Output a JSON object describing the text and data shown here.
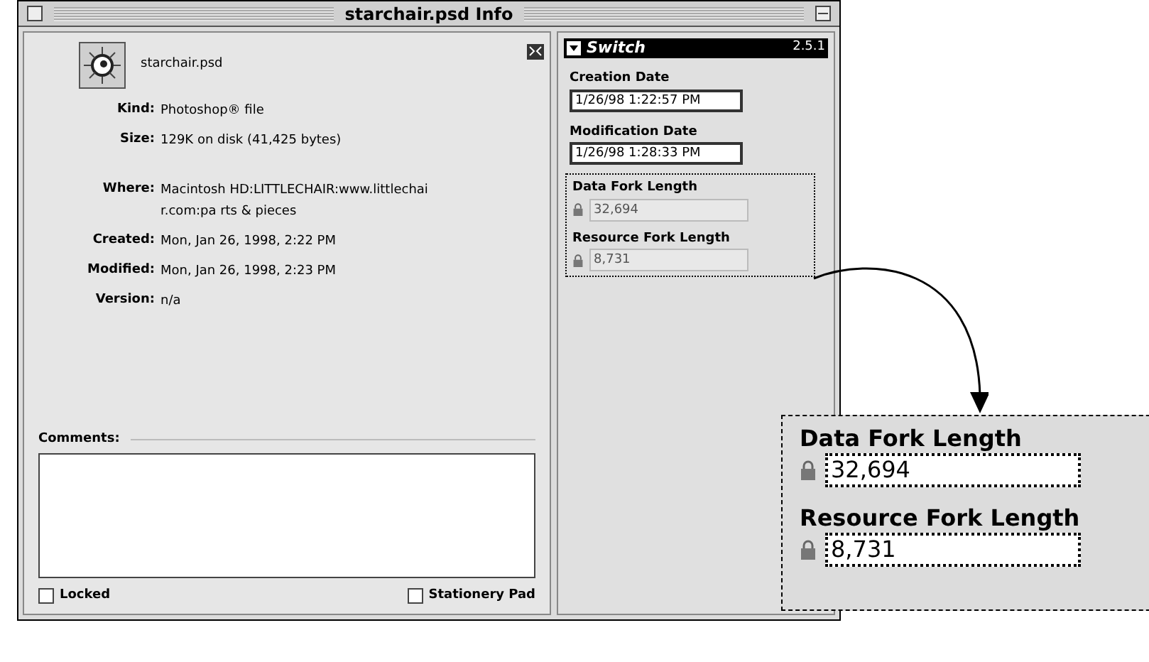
{
  "window": {
    "title": "starchair.psd Info"
  },
  "file": {
    "name": "starchair.psd"
  },
  "info": [
    {
      "label": "Kind:",
      "value": "Photoshop® file"
    },
    {
      "label": "Size:",
      "value": "129K on disk (41,425 bytes)"
    },
    {
      "label": "Where:",
      "value": "Macintosh HD:LITTLECHAIR:www.littlechair.com:pa rts & pieces"
    },
    {
      "label": "Created:",
      "value": "Mon, Jan 26, 1998, 2:22 PM"
    },
    {
      "label": "Modified:",
      "value": "Mon, Jan 26, 1998, 2:23 PM"
    },
    {
      "label": "Version:",
      "value": "n/a"
    }
  ],
  "comments": {
    "label": "Comments:"
  },
  "checkboxes": [
    {
      "label": "Locked",
      "checked": false
    },
    {
      "label": "Stationery Pad",
      "checked": false
    }
  ],
  "plugin": {
    "title": "Switch",
    "version": "2.5.1",
    "fields": [
      {
        "label": "Creation Date",
        "value": "1/26/98 1:22:57 PM",
        "kind": "editable"
      },
      {
        "label": "Modification Date",
        "value": "1/26/98 1:28:33 PM",
        "kind": "editable"
      },
      {
        "label": "Data Fork Length",
        "value": "32,694",
        "kind": "locked"
      },
      {
        "label": "Resource Fork Length",
        "value": "8,731",
        "kind": "locked"
      }
    ]
  },
  "callout": {
    "fields": [
      {
        "label": "Data Fork Length",
        "value": "32,694"
      },
      {
        "label": "Resource Fork Length",
        "value": "8,731"
      }
    ]
  }
}
